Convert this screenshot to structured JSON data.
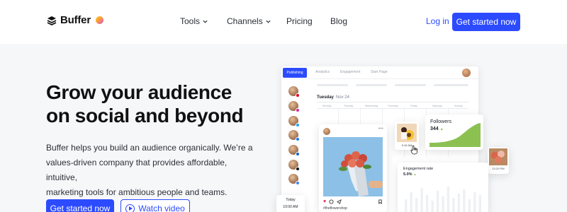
{
  "nav": {
    "logo_text": "Buffer",
    "links": [
      {
        "label": "Tools",
        "has_dropdown": true
      },
      {
        "label": "Channels",
        "has_dropdown": true
      },
      {
        "label": "Pricing",
        "has_dropdown": false
      },
      {
        "label": "Blog",
        "has_dropdown": false
      }
    ],
    "login_label": "Log in",
    "cta_label": "Get started now"
  },
  "hero": {
    "headline_line1": "Grow your audience",
    "headline_line2": "on social and beyond",
    "description_line1": "Buffer helps you build an audience organically. We’re a",
    "description_line2": "values-driven company that provides affordable, intuitive,",
    "description_line3": "marketing tools for ambitious people and teams.",
    "cta_label": "Get started now",
    "watch_label": "Watch video"
  },
  "mockup": {
    "tabs": [
      "Publishing",
      "Analytics",
      "Engagement",
      "Start Page"
    ],
    "day": "Tuesday",
    "date": "Nov 24",
    "columns": [
      "Monday",
      "Tuesday",
      "Wednesday",
      "Thursday",
      "Friday",
      "Saturday",
      "Sunday"
    ],
    "channels": [
      {
        "network": "pinterest",
        "color": "#e60023"
      },
      {
        "network": "instagram",
        "color": "#d6249f"
      },
      {
        "network": "twitter",
        "color": "#1da1f2"
      },
      {
        "network": "facebook",
        "color": "#1877f2"
      },
      {
        "network": "linkedin",
        "color": "#0a66c2"
      },
      {
        "network": "tiktok",
        "color": "#111111"
      },
      {
        "network": "google-business",
        "color": "#4285f4"
      }
    ],
    "post": {
      "hashtag": "#theflowershop"
    },
    "scheduled_time": "9:15 AM",
    "followers": {
      "label": "Followers",
      "value": "344",
      "trend": "up"
    },
    "photo_time": "12:20 PM",
    "engagement": {
      "label": "Engagement rate",
      "value": "5.0%",
      "trend": "up",
      "bars": [
        0.45,
        0.7,
        0.5,
        0.85,
        0.6,
        0.4,
        0.75,
        0.55,
        0.9,
        0.5,
        0.65,
        0.8,
        0.45,
        0.7,
        0.6
      ]
    },
    "time_card": {
      "label": "Today",
      "time": "10:00 AM"
    }
  },
  "colors": {
    "brand_blue": "#2c4bff",
    "page_bg": "#f6f7f9",
    "followers_green": "#8cc152"
  }
}
